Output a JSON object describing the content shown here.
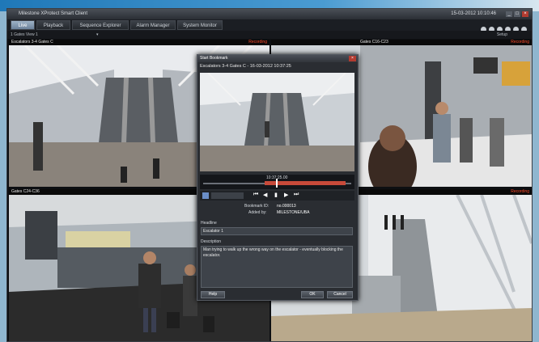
{
  "window": {
    "title": "Milestone XProtect Smart Client",
    "datetime": "15-03-2012 10:10:46"
  },
  "tabs": [
    {
      "label": "Live",
      "active": true
    },
    {
      "label": "Playback",
      "active": false
    },
    {
      "label": "Sequence Explorer",
      "active": false
    },
    {
      "label": "Alarm Manager",
      "active": false
    },
    {
      "label": "System Monitor",
      "active": false
    }
  ],
  "viewbar": {
    "view_label": "1 Gates View 1",
    "setup_label": "Setup"
  },
  "cameras": [
    {
      "name": "Escalators 3-4 Gates C",
      "status": "Recording"
    },
    {
      "name": "Gates C16-C23",
      "status": "Recording"
    },
    {
      "name": "Gates C24-C36",
      "status": ""
    },
    {
      "name": "",
      "status": "Recording"
    }
  ],
  "dialog": {
    "title": "Start Bookmark",
    "camera_line": "Escalators 3-4 Gates C - 16-03-2012 10:37:25",
    "timeline_time": "10:37:25.00",
    "bookmark_id_label": "Bookmark ID:",
    "bookmark_id_value": "no.000013",
    "added_by_label": "Added by:",
    "added_by_value": "MILESTONE/UBA",
    "headline_label": "Headline",
    "headline_value": "Escalator 1",
    "description_label": "Description",
    "description_value": "Man trying to walk up the wrong way on the escalator - eventually blocking the escalator.",
    "help_label": "Help",
    "ok_label": "OK",
    "cancel_label": "Cancel"
  },
  "colors": {
    "accent": "#ff4b2b",
    "header_bg": "#0a0a0a",
    "tab_active": "#8ea3b8"
  }
}
